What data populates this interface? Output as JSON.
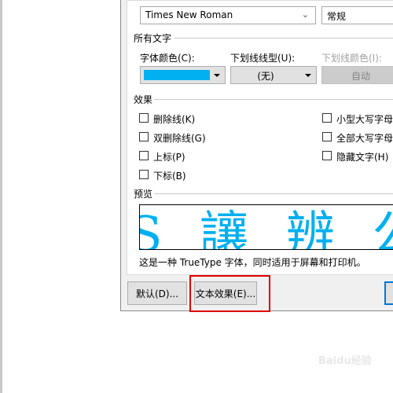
{
  "font": {
    "family_value": "Times New Roman",
    "style_value": "常规"
  },
  "all_text": {
    "title": "所有文字",
    "font_color_label": "字体颜色(C):",
    "font_color": "#00b0f0",
    "underline_label": "下划线线型(U):",
    "underline_value": "(无)",
    "underline_color_label": "下划线颜色(I):",
    "underline_color_value": "自动"
  },
  "effects": {
    "title": "效果",
    "items": [
      {
        "label": "删除线(K)",
        "checked": false
      },
      {
        "label": "双删除线(G)",
        "checked": false
      },
      {
        "label": "上标(P)",
        "checked": false
      },
      {
        "label": "下标(B)",
        "checked": false
      },
      {
        "label": "小型大写字母",
        "checked": false
      },
      {
        "label": "全部大写字母",
        "checked": false
      },
      {
        "label": "隐藏文字(H)",
        "checked": false
      }
    ]
  },
  "preview": {
    "title": "预览",
    "sample": "S 讓 辨 公",
    "description": "这是一种 TrueType 字体，同时适用于屏幕和打印机。"
  },
  "buttons": {
    "default": "默认(D)...",
    "text_effects": "文本效果(E)..."
  },
  "highlight_color": "#e00000",
  "watermark": "Baidu经验 jingyan.baidu.com"
}
